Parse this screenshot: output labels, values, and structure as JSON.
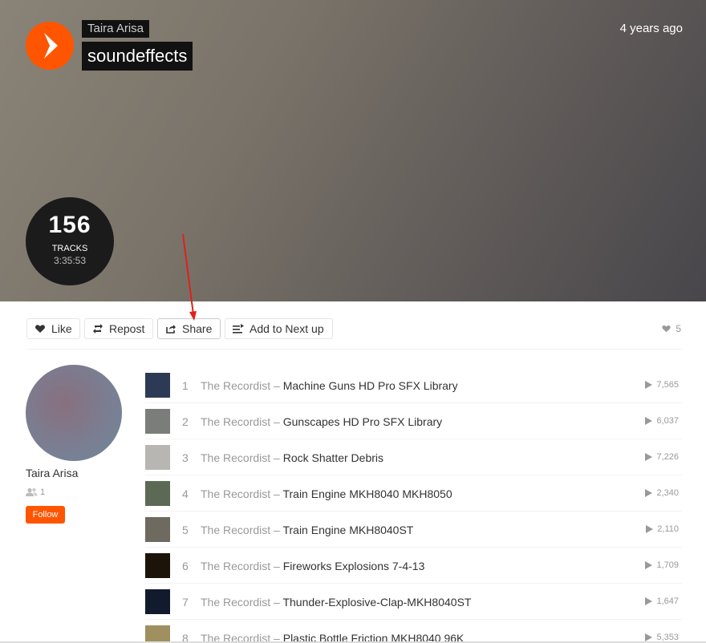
{
  "hero": {
    "user": "Taira Arisa",
    "title": "soundeffects",
    "time": "4 years ago",
    "track_count": "156",
    "tracks_label": "TRACKS",
    "duration": "3:35:53"
  },
  "actions": {
    "like": "Like",
    "repost": "Repost",
    "share": "Share",
    "add_next": "Add to Next up",
    "likes_count": "5"
  },
  "sidebar": {
    "name": "Taira Arisa",
    "followers": "1",
    "follow": "Follow"
  },
  "tracks": [
    {
      "num": "1",
      "artist": "The Recordist",
      "sep": " – ",
      "title": "Machine Guns HD Pro SFX Library",
      "plays": "7,565",
      "thumb_color": "#2d3a55"
    },
    {
      "num": "2",
      "artist": "The Recordist",
      "sep": " – ",
      "title": "Gunscapes HD Pro SFX Library",
      "plays": "6,037",
      "thumb_color": "#7b7d7a"
    },
    {
      "num": "3",
      "artist": "The Recordist",
      "sep": " – ",
      "title": "Rock Shatter Debris",
      "plays": "7,226",
      "thumb_color": "#b7b6b2"
    },
    {
      "num": "4",
      "artist": "The Recordist",
      "sep": " – ",
      "title": "Train Engine MKH8040 MKH8050",
      "plays": "2,340",
      "thumb_color": "#5c6a55"
    },
    {
      "num": "5",
      "artist": "The Recordist",
      "sep": " – ",
      "title": "Train Engine MKH8040ST",
      "plays": "2,110",
      "thumb_color": "#6e6a60"
    },
    {
      "num": "6",
      "artist": "The Recordist",
      "sep": " – ",
      "title": "Fireworks Explosions 7-4-13",
      "plays": "1,709",
      "thumb_color": "#1c1408"
    },
    {
      "num": "7",
      "artist": "The Recordist",
      "sep": " – ",
      "title": "Thunder-Explosive-Clap-MKH8040ST",
      "plays": "1,647",
      "thumb_color": "#121a2e"
    },
    {
      "num": "8",
      "artist": "The Recordist",
      "sep": " – ",
      "title": "Plastic Bottle Friction MKH8040 96K",
      "plays": "5,353",
      "thumb_color": "#a09060"
    }
  ],
  "colors": {
    "accent": "#ff5500",
    "annotation": "#e0201a"
  },
  "icons": [
    "play-icon",
    "heart-icon",
    "repost-icon",
    "share-icon",
    "add-to-queue-icon",
    "followers-icon",
    "play-count-icon"
  ]
}
